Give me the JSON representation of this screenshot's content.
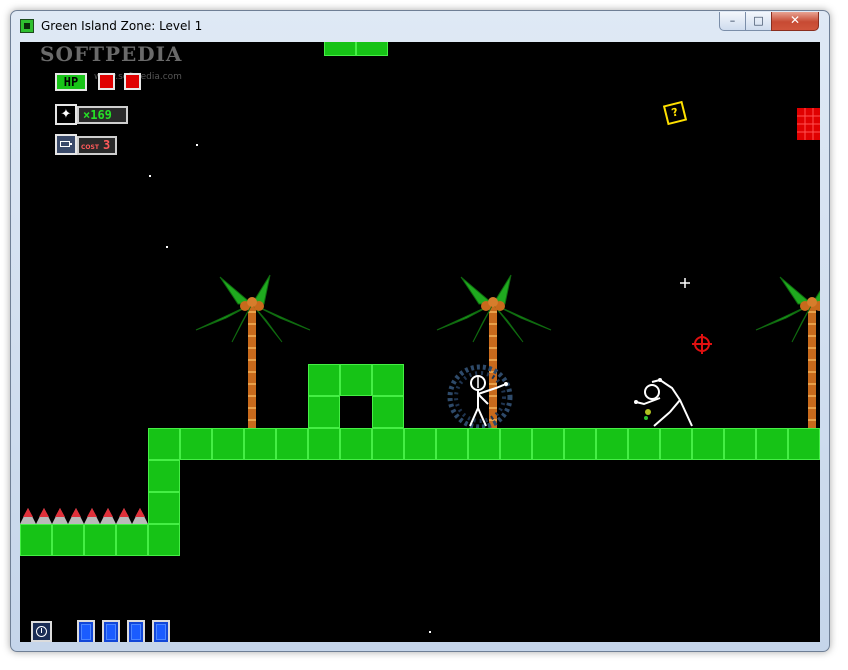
{
  "window": {
    "title": "Green Island Zone: Level 1",
    "minimize_glyph": "–",
    "maximize_glyph": "□",
    "close_glyph": "✕"
  },
  "watermark": {
    "text": "SOFTPEDIA",
    "subtext": "www.softpedia.com"
  },
  "hud": {
    "hp_label": "HP",
    "hearts": 2,
    "star_icon": "sparkle-icon",
    "star_glyph": "✦",
    "star_count": "×169",
    "item_icon": "battery-icon",
    "cost_label": "COST",
    "cost_value": "3"
  },
  "mystery_box": {
    "glyph": "?"
  },
  "inventory": {
    "special_slot_icon": "clock-icon",
    "slots": 4
  },
  "colors": {
    "ground": "#16c316",
    "ground_edge": "#45ef45",
    "palm_leaf": "#1faa1f",
    "palm_trunk": "#c86a1c",
    "spike": "#e0303a",
    "crosshair": "#e01010",
    "mystery_box": "#ffe000",
    "red_block": "#e00000"
  },
  "characters": [
    {
      "name": "player",
      "label": "stick-figure-player-with-shield"
    },
    {
      "name": "enemy",
      "label": "stick-figure-enemy"
    }
  ]
}
